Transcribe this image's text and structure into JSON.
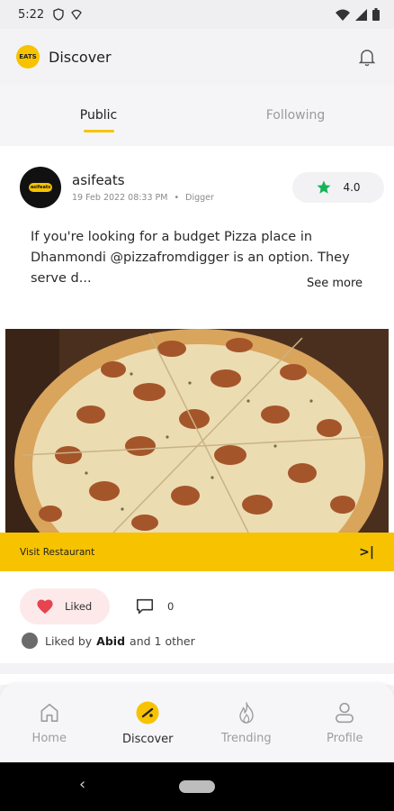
{
  "status_bar": {
    "time": "5:22"
  },
  "header": {
    "logo_text": "EATS",
    "title": "Discover"
  },
  "tabs": [
    {
      "label": "Public",
      "active": true
    },
    {
      "label": "Following",
      "active": false
    }
  ],
  "post": {
    "author": "asifeats",
    "avatar_text": "asifeats",
    "date": "19 Feb 2022 08:33 PM",
    "separator": "•",
    "restaurant": "Digger",
    "rating": "4.0",
    "text": "If you're looking for a budget Pizza place in Dhanmondi @pizzafromdigger is an option. They serve d...",
    "see_more": "See more",
    "visit_label": "Visit Restaurant",
    "visit_icon": ">|",
    "liked_label": "Liked",
    "comment_count": "0",
    "liked_by_prefix": "Liked by",
    "liked_by_name": "Abid",
    "liked_by_suffix": "and 1 other"
  },
  "bottom_nav": [
    {
      "label": "Home",
      "icon": "home-icon",
      "active": false
    },
    {
      "label": "Discover",
      "icon": "discover-icon",
      "active": true
    },
    {
      "label": "Trending",
      "icon": "trending-flame-icon",
      "active": false
    },
    {
      "label": "Profile",
      "icon": "profile-icon",
      "active": false
    }
  ],
  "colors": {
    "accent": "#f7c300",
    "heart": "#e8434f",
    "star": "#16b35a"
  }
}
